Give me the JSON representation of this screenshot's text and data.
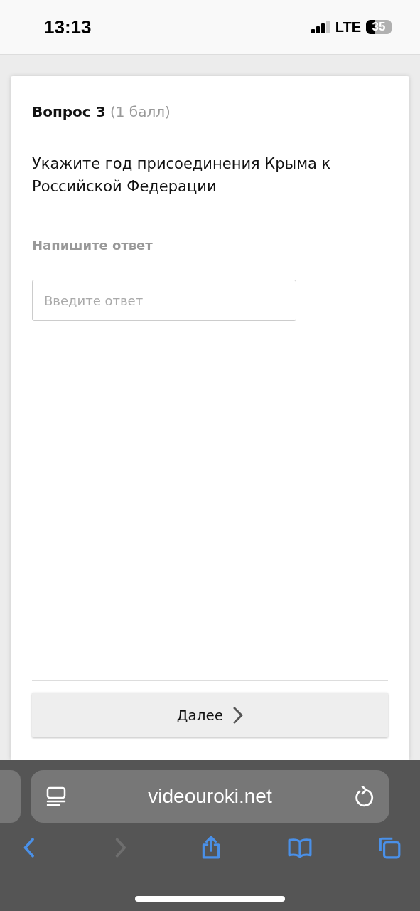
{
  "status_bar": {
    "time": "13:13",
    "network": "LTE",
    "battery": "35"
  },
  "question": {
    "title": "Вопрос 3",
    "points": "(1 балл)",
    "text": "Укажите год присоединения Крыма к Российской Федерации",
    "answer_label": "Напишите ответ",
    "answer_field": {
      "placeholder": "Введите ответ"
    },
    "next_button": "Далее"
  },
  "browser": {
    "url": "videouroki.net",
    "toolbar": [
      {
        "kind": "back",
        "disabled": false
      },
      {
        "kind": "forward",
        "disabled": true
      },
      {
        "kind": "share",
        "disabled": false
      },
      {
        "kind": "bookmarks",
        "disabled": false
      },
      {
        "kind": "tabs",
        "disabled": false
      }
    ]
  }
}
